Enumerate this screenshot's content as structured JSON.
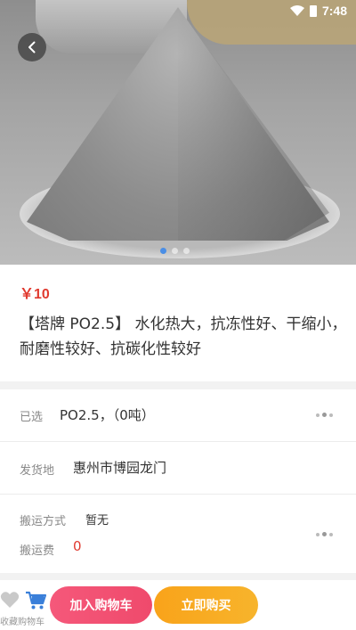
{
  "status_bar": {
    "time": "7:48"
  },
  "hero": {
    "image_description_icon": "cement-powder-image",
    "carousel_count": 3,
    "active_index": 0
  },
  "product": {
    "price": "￥10",
    "title": "【塔牌 PO2.5】 水化热大，抗冻性好、干缩小，耐磨性较好、抗碳化性较好"
  },
  "options": {
    "selected_label": "已选",
    "selected_value": "PO2.5，（0吨）",
    "ship_from_label": "发货地",
    "ship_from_value": "惠州市博园龙门",
    "shipping_method_label": "搬运方式",
    "shipping_method_value": "暂无",
    "shipping_fee_label": "搬运费",
    "shipping_fee_value": "0"
  },
  "bottom_bar": {
    "fav_cart_label": "收藏购物车",
    "add_to_cart_label": "加入购物车",
    "buy_now_label": "立即购买"
  },
  "colors": {
    "price": "#e03a2f",
    "add_to_cart": "#f5587a",
    "buy_now": "#f9a31a",
    "active_dot": "#4a8ee6"
  }
}
